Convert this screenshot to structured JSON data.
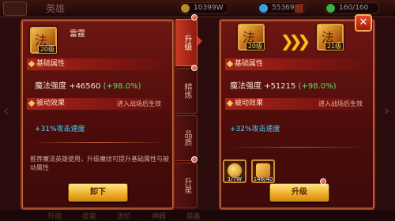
{
  "topbar": {
    "title": "英雄",
    "gold": "10399W",
    "diamond": "55369",
    "stamina": "160/160"
  },
  "bottom_tabs": [
    "升级",
    "技能",
    "进阶",
    "神器",
    "装备"
  ],
  "tabs": [
    {
      "label": "升级",
      "active": true
    },
    {
      "label": "精炼",
      "active": false
    },
    {
      "label": "品质",
      "active": false
    },
    {
      "label": "升星",
      "active": false
    }
  ],
  "left": {
    "skill_name": "雷霆",
    "skill_glyph": "法",
    "skill_level": "20级",
    "basic_title": "基础属性",
    "stat_label": "魔法强度",
    "stat_value": "+46560",
    "stat_pct": "(+98.0%)",
    "passive_title": "被动效果",
    "passive_note": "进入战场后生效",
    "passive_effect": "+31%攻击速度",
    "description": "推荐魔法英雄使用，升级魔纹可提升基础属性与被动属性",
    "unload_label": "卸下"
  },
  "right": {
    "skill_glyph": "法",
    "skill_level": "21级",
    "basic_title": "基础属性",
    "stat_label": "魔法强度",
    "stat_value": "+51215",
    "stat_pct": "(+98.0%)",
    "passive_title": "被动效果",
    "passive_note": "进入战场后生效",
    "passive_effect": "+32%攻击速度",
    "materials": [
      {
        "count": "1/7W",
        "icon": "coin-icon"
      },
      {
        "count": "146/40",
        "icon": "rune-material-icon"
      }
    ],
    "upgrade_label": "升级"
  },
  "colors": {
    "accent_gold": "#f0b12a",
    "passive_blue": "#4ad6ff",
    "pct_green": "#56e060",
    "panel_red": "#6e1612"
  }
}
